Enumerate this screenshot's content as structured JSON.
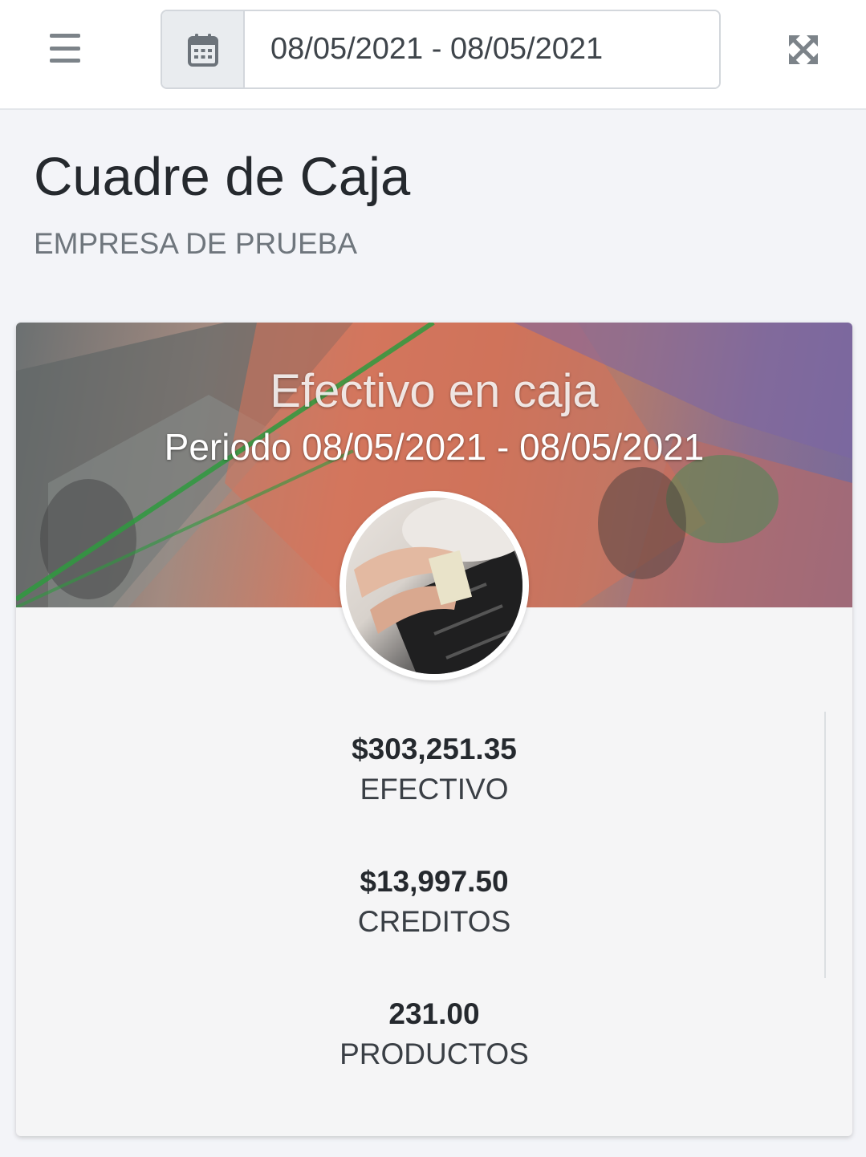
{
  "topbar": {
    "date_range_value": "08/05/2021 - 08/05/2021"
  },
  "page": {
    "title": "Cuadre de Caja",
    "subtitle": "EMPRESA DE PRUEBA"
  },
  "card": {
    "title": "Efectivo en caja",
    "period": "Periodo 08/05/2021 - 08/05/2021",
    "stats": [
      {
        "value": "$303,251.35",
        "label": "EFECTIVO"
      },
      {
        "value": "$13,997.50",
        "label": "CREDITOS"
      },
      {
        "value": "231.00",
        "label": "PRODUCTOS"
      }
    ]
  },
  "icons": {
    "menu": "hamburger-icon",
    "calendar": "calendar-icon",
    "expand": "expand-icon"
  },
  "colors": {
    "topbar_bg": "#ffffff",
    "page_bg": "#f3f4f8",
    "card_bg": "#f5f5f6",
    "addon_bg": "#e9ecef"
  }
}
